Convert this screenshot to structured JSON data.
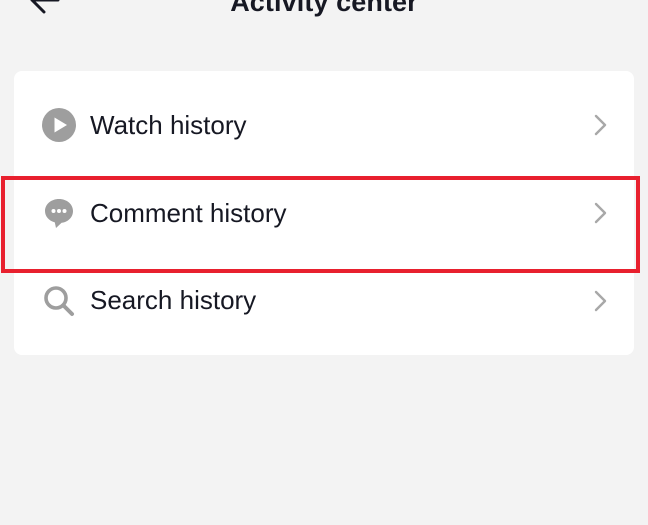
{
  "header": {
    "title": "Activity center"
  },
  "items": [
    {
      "label": "Watch history",
      "icon": "play-circle-icon"
    },
    {
      "label": "Comment history",
      "icon": "comment-bubble-icon"
    },
    {
      "label": "Search history",
      "icon": "search-icon"
    }
  ],
  "colors": {
    "background": "#f3f3f3",
    "card": "#ffffff",
    "icon": "#9e9e9e",
    "chevron": "#a8a8a8",
    "text": "#161823",
    "highlight": "#e8202e"
  }
}
